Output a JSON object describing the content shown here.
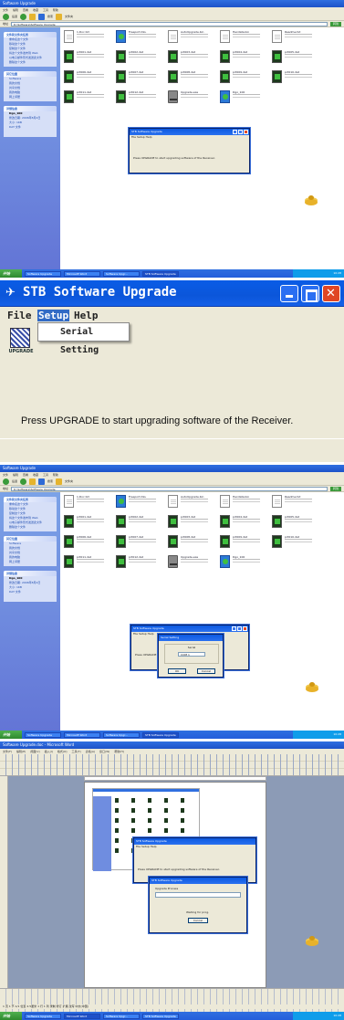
{
  "explorer": {
    "title": "Software Upgrade",
    "menu": [
      "文件",
      "编辑",
      "查看",
      "收藏",
      "工具",
      "帮助"
    ],
    "back_label": "后退",
    "search_label": "搜索",
    "folders_label": "文件夹",
    "address_label": "地址",
    "address": "D:\\Software\\Software Upgrade",
    "go_label": "转到",
    "sidebar": {
      "tasks_header": "文件和文件夹任务",
      "tasks": [
        "重命名这个文件",
        "移动这个文件",
        "复制这个文件",
        "将这个文件发布到 Web",
        "以电子邮件形式发送此文件",
        "删除这个文件"
      ],
      "places_header": "其它位置",
      "places": [
        "Software",
        "我的文档",
        "共享文档",
        "我的电脑",
        "网上邻居"
      ],
      "details_header": "详细信息",
      "details_name": "Dgo_100",
      "details_lines": [
        "修改日期: 2006年8月4日",
        "大小: 1KB",
        "DAT 文件"
      ]
    },
    "files": [
      {
        "name": "1.Doc.txt",
        "kind": "doc"
      },
      {
        "name": "Freeport.DLL",
        "kind": "inst"
      },
      {
        "name": "AutoUpgrade.bin",
        "kind": "doc"
      },
      {
        "name": "Hexdata.bin",
        "kind": "doc"
      },
      {
        "name": "Readme.txt",
        "kind": "doc"
      },
      {
        "name": "prt001.dat",
        "kind": "dat"
      },
      {
        "name": "prt002.dat",
        "kind": "dat"
      },
      {
        "name": "prt003.dat",
        "kind": "dat"
      },
      {
        "name": "prt004.dat",
        "kind": "dat"
      },
      {
        "name": "prt005.dat",
        "kind": "dat"
      },
      {
        "name": "prt006.dat",
        "kind": "dat"
      },
      {
        "name": "prt007.dat",
        "kind": "dat"
      },
      {
        "name": "prt008.dat",
        "kind": "dat"
      },
      {
        "name": "prt009.dat",
        "kind": "dat"
      },
      {
        "name": "prt010.dat",
        "kind": "dat"
      },
      {
        "name": "prt011.dat",
        "kind": "dat"
      },
      {
        "name": "prt012.dat",
        "kind": "dat"
      },
      {
        "name": "Upgrade.exe",
        "kind": "drv"
      },
      {
        "name": "Dgo_100",
        "kind": "inst"
      }
    ],
    "taskbar": {
      "start": "开始",
      "tasks": [
        "Software Upgrade",
        "Microsoft Word",
        "Software Upgr...",
        "STB Software Upgrade"
      ],
      "clock": "10:28"
    }
  },
  "mini_dialog": {
    "title": "STB Software Upgrade",
    "menu": "File Setup Help",
    "message": "Press UPGRADE to start upgrading software of the Receiver."
  },
  "serial_dialog": {
    "title": "Serial Setting",
    "group": "Serial",
    "port": "COM 1",
    "ok": "OK",
    "cancel": "Cancel"
  },
  "upgrade_dialog": {
    "title": "STB Software Upgrade",
    "status_label": "Upgrade Process",
    "waiting": "Waiting for prog.",
    "button": "Cancel"
  },
  "word": {
    "title": "Software Upgrade.doc - Microsoft Word",
    "menu": [
      "文件(F)",
      "编辑(E)",
      "视图(V)",
      "插入(I)",
      "格式(O)",
      "工具(T)",
      "表格(A)",
      "窗口(W)",
      "帮助(H)"
    ],
    "status": "1 页 1 节 1/1 位置 2.5厘米 1 行 1 列 录制 修订 扩展 改写 中文(中国)"
  },
  "zoom": {
    "title": "STB Software Upgrade",
    "menu_file": "File",
    "menu_setup": "Setup",
    "menu_help": "Help",
    "dropdown_item": "Serial Setting",
    "upgrade_caption": "UPGRADE",
    "message": "Press UPGRADE  to start upgrading software of the Receiver."
  },
  "colors": {
    "xp_blue": "#0a5ce6",
    "close_red": "#e04624",
    "dialog_bg": "#ece9d8",
    "menu_highlight": "#316ac5"
  }
}
